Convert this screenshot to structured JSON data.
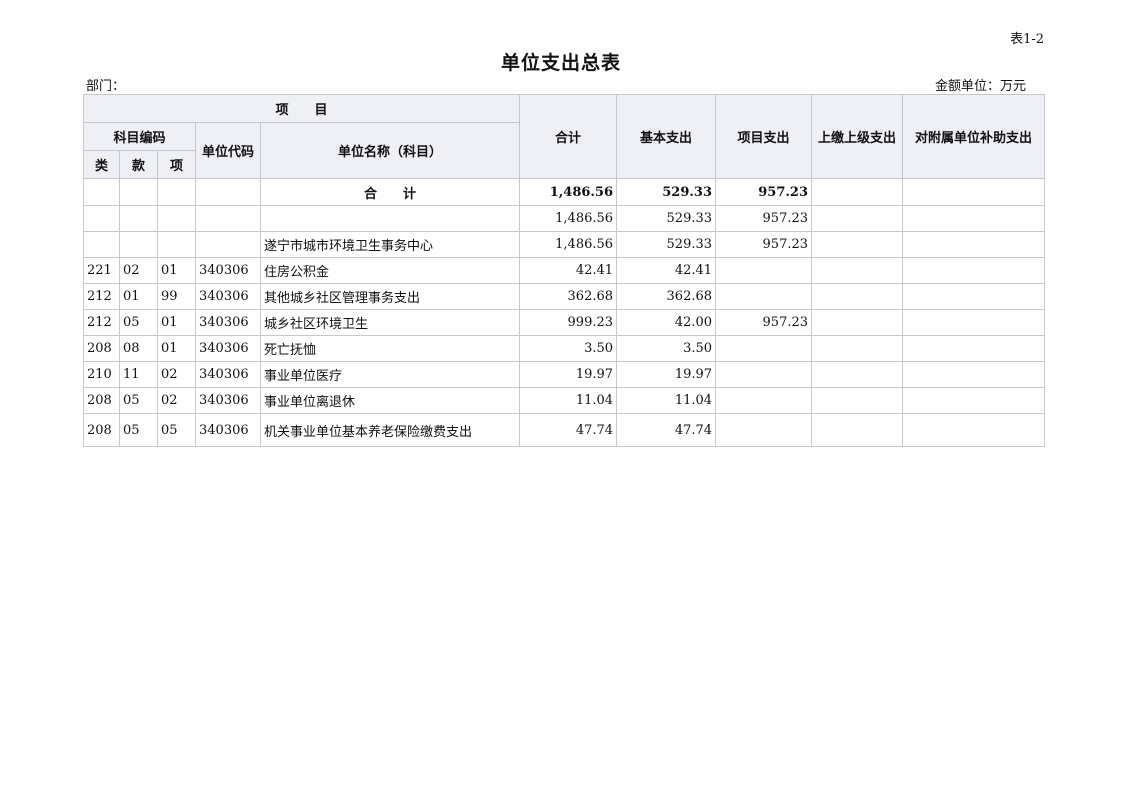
{
  "header": {
    "table_id": "表1-2",
    "title": "单位支出总表",
    "dept_label": "部门：",
    "unit_label": "金额单位：万元"
  },
  "columns": {
    "project": "项　　目",
    "subject_code": "科目编码",
    "lei": "类",
    "kuan": "款",
    "xiang": "项",
    "unit_code": "单位代码",
    "unit_name": "单位名称（科目）",
    "total": "合计",
    "basic": "基本支出",
    "project_exp": "项目支出",
    "upper_pay": "上缴上级支出",
    "subsidiary": "对附属单位补助支出"
  },
  "total_row": {
    "label": "合　　计",
    "total": "1,486.56",
    "basic": "529.33",
    "project": "957.23",
    "upper": "",
    "subsidy": ""
  },
  "rows": [
    {
      "lei": "",
      "kuan": "",
      "xiang": "",
      "code": "",
      "name": "",
      "total": "1,486.56",
      "basic": "529.33",
      "project": "957.23",
      "upper": "",
      "subsidy": ""
    },
    {
      "lei": "",
      "kuan": "",
      "xiang": "",
      "code": "",
      "name": "遂宁市城市环境卫生事务中心",
      "total": "1,486.56",
      "basic": "529.33",
      "project": "957.23",
      "upper": "",
      "subsidy": ""
    },
    {
      "lei": "221",
      "kuan": "02",
      "xiang": "01",
      "code": "340306",
      "name": "住房公积金",
      "total": "42.41",
      "basic": "42.41",
      "project": "",
      "upper": "",
      "subsidy": ""
    },
    {
      "lei": "212",
      "kuan": "01",
      "xiang": "99",
      "code": "340306",
      "name": "其他城乡社区管理事务支出",
      "total": "362.68",
      "basic": "362.68",
      "project": "",
      "upper": "",
      "subsidy": ""
    },
    {
      "lei": "212",
      "kuan": "05",
      "xiang": "01",
      "code": "340306",
      "name": "城乡社区环境卫生",
      "total": "999.23",
      "basic": "42.00",
      "project": "957.23",
      "upper": "",
      "subsidy": ""
    },
    {
      "lei": "208",
      "kuan": "08",
      "xiang": "01",
      "code": "340306",
      "name": "死亡抚恤",
      "total": "3.50",
      "basic": "3.50",
      "project": "",
      "upper": "",
      "subsidy": ""
    },
    {
      "lei": "210",
      "kuan": "11",
      "xiang": "02",
      "code": "340306",
      "name": "事业单位医疗",
      "total": "19.97",
      "basic": "19.97",
      "project": "",
      "upper": "",
      "subsidy": ""
    },
    {
      "lei": "208",
      "kuan": "05",
      "xiang": "02",
      "code": "340306",
      "name": "事业单位离退休",
      "total": "11.04",
      "basic": "11.04",
      "project": "",
      "upper": "",
      "subsidy": ""
    },
    {
      "lei": "208",
      "kuan": "05",
      "xiang": "05",
      "code": "340306",
      "name": "机关事业单位基本养老保险缴费支出",
      "total": "47.74",
      "basic": "47.74",
      "project": "",
      "upper": "",
      "subsidy": ""
    }
  ]
}
